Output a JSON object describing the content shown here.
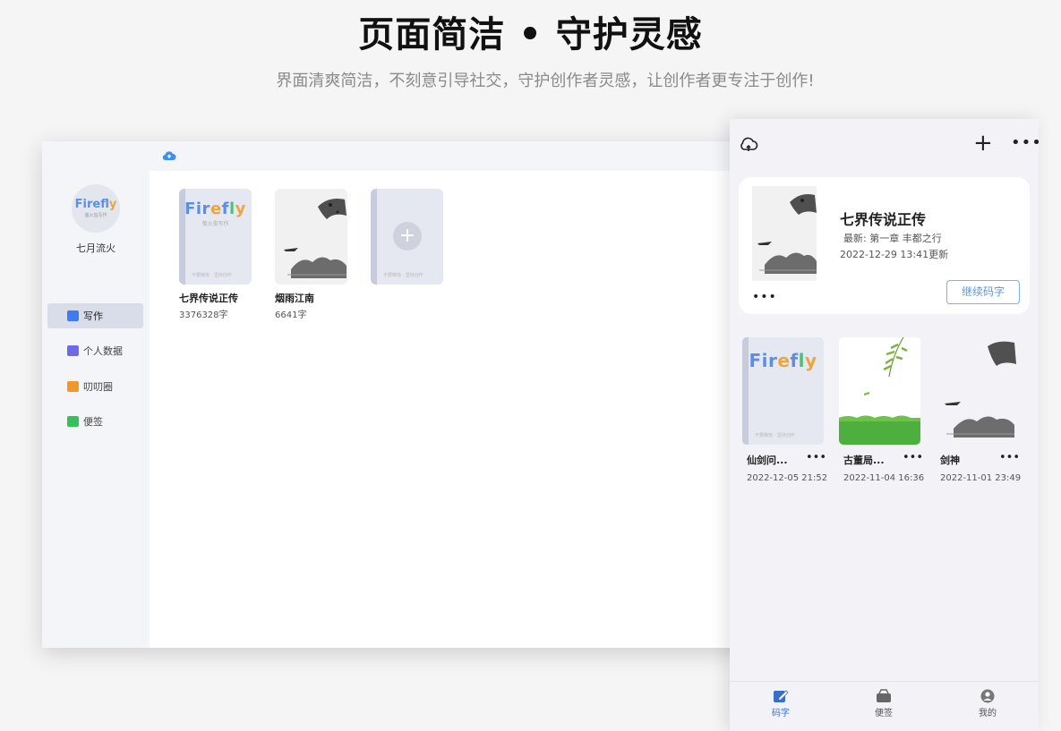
{
  "hero": {
    "title": "页面简洁 • 守护灵感",
    "subtitle": "界面清爽简洁，不刻意引导社交，守护创作者灵感，让创作者更专注于创作!"
  },
  "desktop": {
    "username": "七月流火",
    "avatar_logo": "Firefly",
    "avatar_sub": "萤火虫写作",
    "nav": [
      {
        "label": "写作",
        "icon": "edit-icon",
        "color": "#3d7bf0",
        "active": true
      },
      {
        "label": "个人数据",
        "icon": "chart-icon",
        "color": "#6c6ae8",
        "active": false
      },
      {
        "label": "叨叨圈",
        "icon": "chat-icon",
        "color": "#f0962b",
        "active": false
      },
      {
        "label": "便签",
        "icon": "bag-icon",
        "color": "#37c05a",
        "active": false
      }
    ],
    "books": [
      {
        "title": "七界传说正传",
        "count": "3376328字",
        "cover": "firefly"
      },
      {
        "title": "烟雨江南",
        "count": "6641字",
        "cover": "ink"
      }
    ],
    "cover_logo": "Firefly",
    "cover_sub": "萤火虫写作",
    "cover_footer": "不要懒惰 · 坚持创作"
  },
  "phone": {
    "card": {
      "title": "七界传说正传",
      "latest": "最新: 第一章 丰都之行",
      "time": "2022-12-29 13:41更新",
      "more": "•••",
      "continue_label": "继续码字"
    },
    "books": [
      {
        "name": "仙剑问...",
        "time": "2022-12-05 21:52",
        "cover": "firefly"
      },
      {
        "name": "古董局...",
        "time": "2022-11-04 16:36",
        "cover": "willow"
      },
      {
        "name": "剑神",
        "time": "2022-11-01 23:49",
        "cover": "ink"
      }
    ],
    "book_more": "•••",
    "tabs": [
      {
        "label": "码字",
        "active": true
      },
      {
        "label": "便签",
        "active": false
      },
      {
        "label": "我的",
        "active": false
      }
    ]
  },
  "colors": {
    "accent": "#3a6fc7",
    "brand_blue": "#5b8fe6",
    "brand_orange": "#f0a53a"
  }
}
